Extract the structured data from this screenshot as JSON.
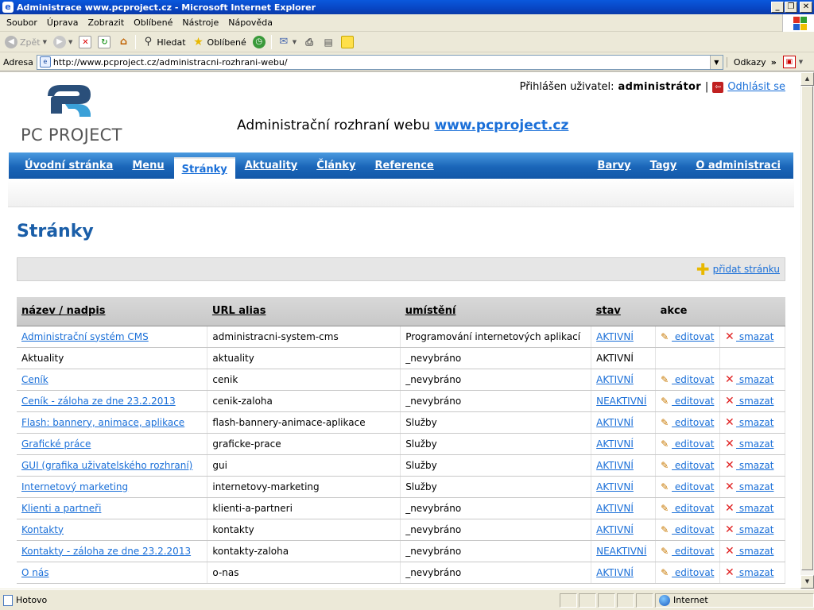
{
  "window": {
    "title": "Administrace www.pcproject.cz - Microsoft Internet Explorer",
    "minimize": "_",
    "maximize": "❐",
    "close": "✕"
  },
  "menu": {
    "items": [
      "Soubor",
      "Úprava",
      "Zobrazit",
      "Oblíbené",
      "Nástroje",
      "Nápověda"
    ]
  },
  "toolbar": {
    "back": "Zpět",
    "search": "Hledat",
    "favorites": "Oblíbené"
  },
  "address": {
    "label": "Adresa",
    "url": "http://www.pcproject.cz/administracni-rozhrani-webu/",
    "links": "Odkazy"
  },
  "header": {
    "logo_text": "PC PROJECT",
    "user_label": "Přihlášen uživatel:",
    "user_name": "administrátor",
    "separator": "|",
    "logout": "Odhlásit se",
    "headline_text": "Administrační rozhraní webu",
    "headline_link": "www.pcproject.cz"
  },
  "nav": {
    "left": [
      "Úvodní stránka",
      "Menu",
      "Stránky",
      "Aktuality",
      "Články",
      "Reference"
    ],
    "right": [
      "Barvy",
      "Tagy",
      "O administraci"
    ],
    "active": "Stránky"
  },
  "main": {
    "title": "Stránky",
    "add_link": "přidat stránku"
  },
  "table": {
    "headers": [
      "název / nadpis",
      "URL alias",
      "umístění",
      "stav",
      "akce"
    ],
    "edit_label": " editovat",
    "delete_label": " smazat",
    "rows": [
      {
        "name": "Administrační systém CMS",
        "alias": "administracni-system-cms",
        "place": "Programování internetových aplikací",
        "state": "AKTIVNÍ",
        "link": true,
        "actions": true
      },
      {
        "name": "Aktuality",
        "alias": "aktuality",
        "place": "_nevybráno",
        "state": "AKTIVNÍ",
        "link": false,
        "actions": false
      },
      {
        "name": "Ceník",
        "alias": "cenik",
        "place": "_nevybráno",
        "state": "AKTIVNÍ",
        "link": true,
        "actions": true
      },
      {
        "name": "Ceník - záloha ze dne 23.2.2013",
        "alias": "cenik-zaloha",
        "place": "_nevybráno",
        "state": "NEAKTIVNÍ",
        "link": true,
        "actions": true
      },
      {
        "name": "Flash: bannery, animace, aplikace",
        "alias": "flash-bannery-animace-aplikace",
        "place": "Služby",
        "state": "AKTIVNÍ",
        "link": true,
        "actions": true
      },
      {
        "name": "Grafické práce",
        "alias": "graficke-prace",
        "place": "Služby",
        "state": "AKTIVNÍ",
        "link": true,
        "actions": true
      },
      {
        "name": "GUI (grafika uživatelského rozhraní)",
        "alias": "gui",
        "place": "Služby",
        "state": "AKTIVNÍ",
        "link": true,
        "actions": true
      },
      {
        "name": "Internetový marketing",
        "alias": "internetovy-marketing",
        "place": "Služby",
        "state": "AKTIVNÍ",
        "link": true,
        "actions": true
      },
      {
        "name": "Klienti a partneři",
        "alias": "klienti-a-partneri",
        "place": "_nevybráno",
        "state": "AKTIVNÍ",
        "link": true,
        "actions": true
      },
      {
        "name": "Kontakty",
        "alias": "kontakty",
        "place": "_nevybráno",
        "state": "AKTIVNÍ",
        "link": true,
        "actions": true
      },
      {
        "name": "Kontakty - záloha ze dne 23.2.2013",
        "alias": "kontakty-zaloha",
        "place": "_nevybráno",
        "state": "NEAKTIVNÍ",
        "link": true,
        "actions": true
      },
      {
        "name": "O nás",
        "alias": "o-nas",
        "place": "_nevybráno",
        "state": "AKTIVNÍ",
        "link": true,
        "actions": true
      }
    ]
  },
  "status": {
    "text": "Hotovo",
    "zone": "Internet"
  }
}
